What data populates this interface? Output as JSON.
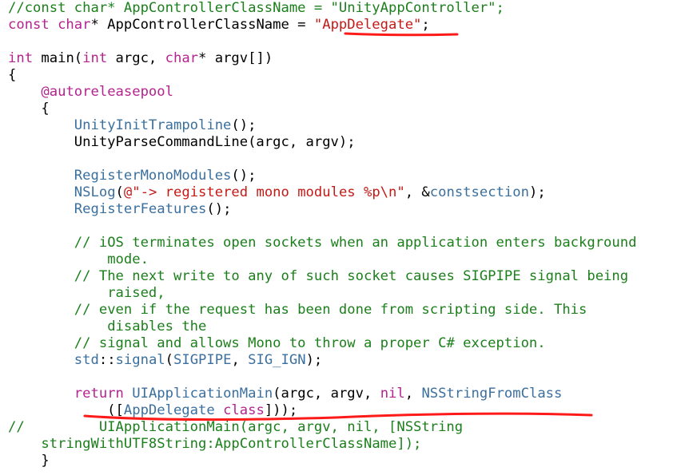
{
  "code": {
    "lines": [
      [
        {
          "t": "//const char* AppControllerClassName = \"UnityAppController\";",
          "c": "cm"
        }
      ],
      [
        {
          "t": "const char",
          "c": "kw"
        },
        {
          "t": "* AppControllerClassName = ",
          "c": "pl"
        },
        {
          "t": "\"AppDelegate\"",
          "c": "str"
        },
        {
          "t": ";",
          "c": "pl"
        }
      ],
      [],
      [
        {
          "t": "int",
          "c": "kw"
        },
        {
          "t": " main(",
          "c": "pl"
        },
        {
          "t": "int",
          "c": "kw"
        },
        {
          "t": " argc, ",
          "c": "pl"
        },
        {
          "t": "char",
          "c": "kw"
        },
        {
          "t": "* argv[])",
          "c": "pl"
        }
      ],
      [
        {
          "t": "{",
          "c": "pl"
        }
      ],
      [
        {
          "t": "    ",
          "c": "pl"
        },
        {
          "t": "@autoreleasepool",
          "c": "kw"
        }
      ],
      [
        {
          "t": "    {",
          "c": "pl"
        }
      ],
      [
        {
          "t": "        ",
          "c": "pl"
        },
        {
          "t": "UnityInitTrampoline",
          "c": "fn"
        },
        {
          "t": "();",
          "c": "pl"
        }
      ],
      [
        {
          "t": "        UnityParseCommandLine(argc, argv);",
          "c": "pl"
        }
      ],
      [],
      [
        {
          "t": "        ",
          "c": "pl"
        },
        {
          "t": "RegisterMonoModules",
          "c": "fn"
        },
        {
          "t": "();",
          "c": "pl"
        }
      ],
      [
        {
          "t": "        ",
          "c": "pl"
        },
        {
          "t": "NSLog",
          "c": "fn"
        },
        {
          "t": "(",
          "c": "pl"
        },
        {
          "t": "@\"-> registered mono modules %p\\n\"",
          "c": "str"
        },
        {
          "t": ", &",
          "c": "pl"
        },
        {
          "t": "constsection",
          "c": "fn"
        },
        {
          "t": ");",
          "c": "pl"
        }
      ],
      [
        {
          "t": "        ",
          "c": "pl"
        },
        {
          "t": "RegisterFeatures",
          "c": "fn"
        },
        {
          "t": "();",
          "c": "pl"
        }
      ],
      [],
      [
        {
          "t": "        ",
          "c": "pl"
        },
        {
          "t": "// iOS terminates open sockets when an application enters background",
          "c": "cm"
        }
      ],
      [
        {
          "t": "            ",
          "c": "pl"
        },
        {
          "t": "mode.",
          "c": "cm"
        }
      ],
      [
        {
          "t": "        ",
          "c": "pl"
        },
        {
          "t": "// The next write to any of such socket causes SIGPIPE signal being",
          "c": "cm"
        }
      ],
      [
        {
          "t": "            ",
          "c": "pl"
        },
        {
          "t": "raised,",
          "c": "cm"
        }
      ],
      [
        {
          "t": "        ",
          "c": "pl"
        },
        {
          "t": "// even if the request has been done from scripting side. This",
          "c": "cm"
        }
      ],
      [
        {
          "t": "            ",
          "c": "pl"
        },
        {
          "t": "disables the",
          "c": "cm"
        }
      ],
      [
        {
          "t": "        ",
          "c": "pl"
        },
        {
          "t": "// signal and allows Mono to throw a proper C# exception.",
          "c": "cm"
        }
      ],
      [
        {
          "t": "        ",
          "c": "pl"
        },
        {
          "t": "std",
          "c": "fn"
        },
        {
          "t": "::",
          "c": "pl"
        },
        {
          "t": "signal",
          "c": "fn"
        },
        {
          "t": "(",
          "c": "pl"
        },
        {
          "t": "SIGPIPE",
          "c": "fn"
        },
        {
          "t": ", ",
          "c": "pl"
        },
        {
          "t": "SIG_IGN",
          "c": "fn"
        },
        {
          "t": ");",
          "c": "pl"
        }
      ],
      [],
      [
        {
          "t": "        ",
          "c": "pl"
        },
        {
          "t": "return",
          "c": "kw"
        },
        {
          "t": " ",
          "c": "pl"
        },
        {
          "t": "UIApplicationMain",
          "c": "fn"
        },
        {
          "t": "(argc, argv, ",
          "c": "pl"
        },
        {
          "t": "nil",
          "c": "kw"
        },
        {
          "t": ", ",
          "c": "pl"
        },
        {
          "t": "NSStringFromClass",
          "c": "fn"
        }
      ],
      [
        {
          "t": "            ([",
          "c": "pl"
        },
        {
          "t": "AppDelegate",
          "c": "fn"
        },
        {
          "t": " ",
          "c": "pl"
        },
        {
          "t": "class",
          "c": "kw"
        },
        {
          "t": "]));",
          "c": "pl"
        }
      ],
      [
        {
          "t": "//         UIApplicationMain(argc, argv, nil, [NSString",
          "c": "cm"
        }
      ],
      [
        {
          "t": "    ",
          "c": "pl"
        },
        {
          "t": "stringWithUTF8String:AppControllerClassName]);",
          "c": "cm"
        }
      ],
      [
        {
          "t": "    }",
          "c": "pl"
        }
      ]
    ]
  },
  "colors": {
    "keyword": "#b4238e",
    "string": "#c41a16",
    "comment": "#1b7f1b",
    "function": "#3a6f9e",
    "plain": "#000000",
    "annotation": "#ff1a1a"
  }
}
